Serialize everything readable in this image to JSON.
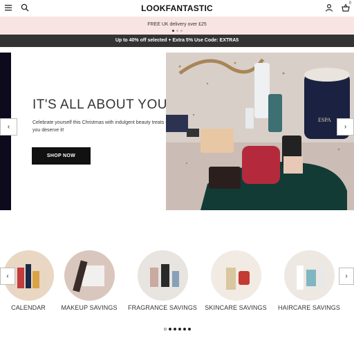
{
  "header": {
    "logo": "LOOKFANTASTIC",
    "basket_count": "0"
  },
  "delivery_banner": {
    "text": "FREE UK delivery over £25"
  },
  "promo_bar": {
    "text": "Up to 40% off selected + Extra 5% Use Code: EXTRA5"
  },
  "hero": {
    "title": "IT'S ALL ABOUT YOU",
    "subtitle": "Celebrate yourself this Christmas with indulgent beauty treats - you deserve it!",
    "cta_label": "SHOP NOW",
    "image_brand_text": "ESPA"
  },
  "categories": {
    "items": [
      {
        "label": "CALENDAR"
      },
      {
        "label": "MAKEUP SAVINGS"
      },
      {
        "label": "FRAGRANCE SAVINGS"
      },
      {
        "label": "SKINCARE SAVINGS"
      },
      {
        "label": "HAIRCARE SAVINGS"
      }
    ]
  },
  "colors": {
    "delivery_bg": "#f8e5e2",
    "promo_bg": "#333333",
    "cta_bg": "#111111"
  },
  "icons": [
    "menu-icon",
    "search-icon",
    "account-icon",
    "basket-icon",
    "chevron-left-icon",
    "chevron-right-icon"
  ]
}
